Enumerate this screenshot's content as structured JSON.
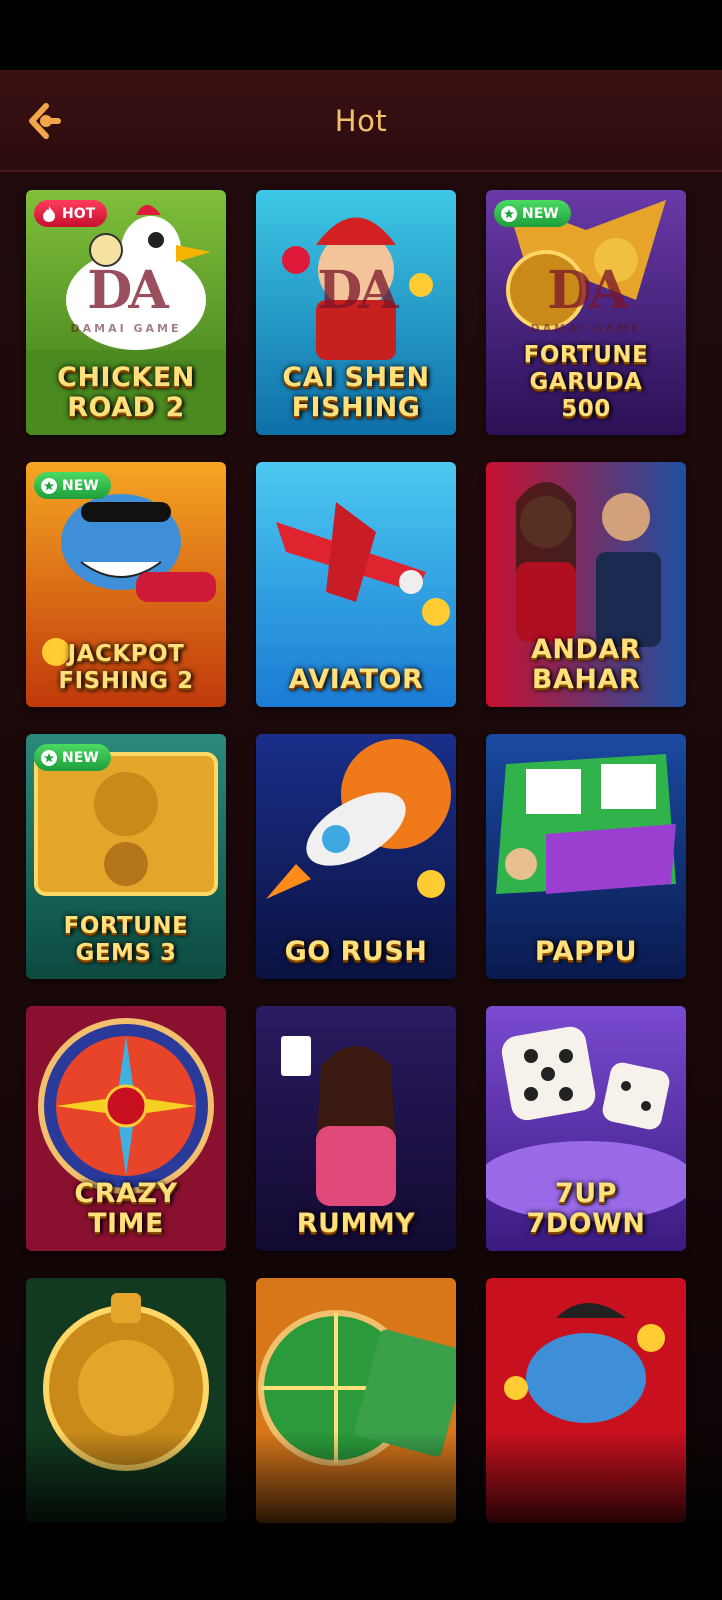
{
  "header": {
    "title": "Hot",
    "back_icon": "back-arrow-icon"
  },
  "colors": {
    "accent": "#f2c06d",
    "hot_badge": "#e0183a",
    "new_badge": "#2bb34a"
  },
  "watermark": {
    "mark": "DA",
    "sub": "DAMAI GAME"
  },
  "games": [
    {
      "title": "CHICKEN\nROAD 2",
      "badge": "HOT",
      "watermark": true
    },
    {
      "title": "CAI SHEN\nFISHING",
      "badge": "",
      "watermark": true
    },
    {
      "title": "FORTUNE GARUDA\n500",
      "badge": "NEW",
      "watermark": true
    },
    {
      "title": "JACKPOT\nFISHING 2",
      "badge": "NEW"
    },
    {
      "title": "AVIATOR",
      "badge": ""
    },
    {
      "title": "ANDAR\nBAHAR",
      "badge": ""
    },
    {
      "title": "FORTUNE\nGEMS 3",
      "badge": "NEW"
    },
    {
      "title": "GO RUSH",
      "badge": ""
    },
    {
      "title": "PAPPU",
      "badge": ""
    },
    {
      "title": "CRAZY\nTIME",
      "badge": ""
    },
    {
      "title": "RUMMY",
      "badge": ""
    },
    {
      "title": "7UP\n7DOWN",
      "badge": ""
    },
    {
      "title": "",
      "badge": ""
    },
    {
      "title": "",
      "badge": ""
    },
    {
      "title": "",
      "badge": ""
    }
  ]
}
